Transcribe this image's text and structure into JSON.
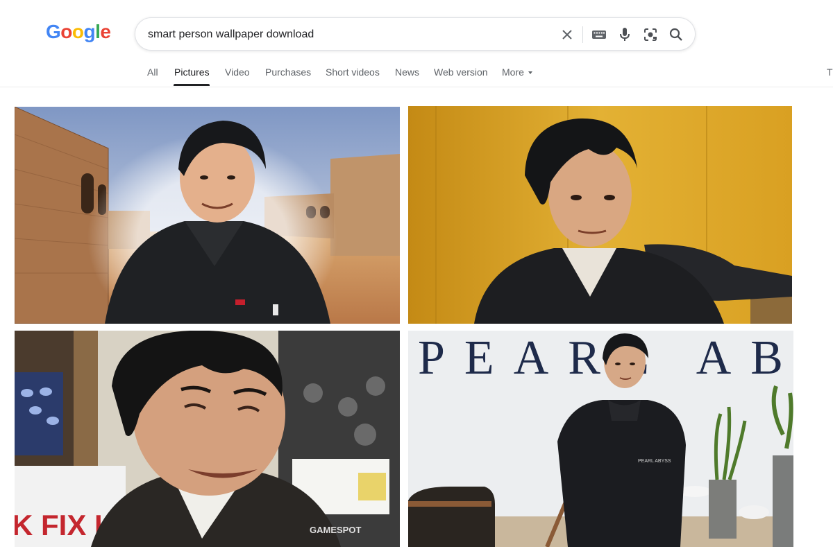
{
  "logo": {
    "letters": [
      "G",
      "o",
      "o",
      "g",
      "l",
      "e"
    ]
  },
  "search": {
    "query": "smart person wallpaper download"
  },
  "tabs": [
    {
      "label": "All"
    },
    {
      "label": "Pictures"
    },
    {
      "label": "Video"
    },
    {
      "label": "Purchases"
    },
    {
      "label": "Short videos"
    },
    {
      "label": "News"
    },
    {
      "label": "Web version"
    },
    {
      "label": "More"
    }
  ],
  "active_tab": "Pictures",
  "clipped_edge_text": "T",
  "results": {
    "image3_watermark": "GAMESPOT",
    "image3_banner": "K FIX K",
    "image4_wall_sign": "PEARL ABYSS",
    "image4_jacket_logo": "PEARL ABYSS"
  },
  "colors": {
    "accent": "#1a73e8",
    "text": "#202124",
    "muted": "#5f6368"
  }
}
